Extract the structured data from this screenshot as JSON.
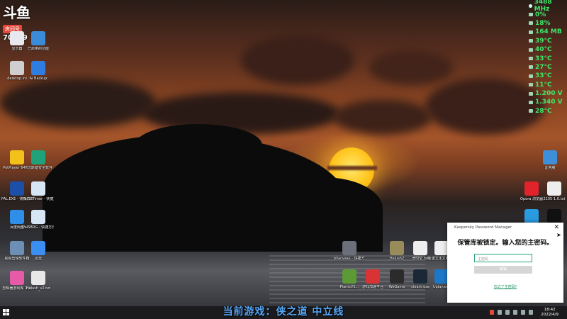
{
  "stream": {
    "logo": "斗鱼",
    "room_tag": "房间号",
    "room_number": "70249",
    "now_playing": "当前游戏：侠之道 中立线"
  },
  "desktop_icons_left": [
    {
      "label": "显示器",
      "icon": "network-icon",
      "color": "#e8e8f0"
    },
    {
      "label": "已启用的功能",
      "icon": "tools-icon",
      "color": "#3a8cd8"
    },
    {
      "label": "desktop.ini",
      "icon": "file-icon",
      "color": "#cfcfcf"
    },
    {
      "label": "Ai Backup",
      "icon": "backup-icon",
      "color": "#2f7de1"
    },
    {
      "label": "PotPlayer 64 bit",
      "icon": "potplayer-icon",
      "color": "#f2c21b"
    },
    {
      "label": "卡巴斯基安全软件",
      "icon": "kaspersky-icon",
      "color": "#1fa27a"
    },
    {
      "label": "PAL.EXE - 快捷方式",
      "icon": "pal-icon",
      "color": "#1b4fa8"
    },
    {
      "label": "PalSBTimer - 快捷方式",
      "icon": "window-icon",
      "color": "#d7e6f5"
    },
    {
      "label": "百度网盘",
      "icon": "baidu-pan-icon",
      "color": "#2f8fe8"
    },
    {
      "label": "PalSBRG - 快捷方式",
      "icon": "window-icon",
      "color": "#d7e6f5"
    },
    {
      "label": "视频剪辑软件箱",
      "icon": "gallery-icon",
      "color": "#6d8fb5"
    },
    {
      "label": "迅雷",
      "icon": "thunder-icon",
      "color": "#3b8ef2"
    },
    {
      "label": "剪辑器游戏库 工具",
      "icon": "game-tool-icon",
      "color": "#e65aa7"
    },
    {
      "label": "Helush_v2.txt",
      "icon": "text-file-icon",
      "color": "#e8e8e8"
    }
  ],
  "desktop_icons_bottom": [
    {
      "label": "bilacvase - 快捷方式",
      "icon": "game-icon",
      "color": "#6a6f7a"
    },
    {
      "label": "Helush2",
      "icon": "sword-icon",
      "color": "#9a8b5a"
    },
    {
      "label": "罗时空.txt",
      "icon": "text-file-icon",
      "color": "#eeeeee"
    },
    {
      "label": "新建文本文档.txt",
      "icon": "text-file-icon",
      "color": "#eeeeee"
    },
    {
      "label": "PlantsVS...",
      "icon": "plants-icon",
      "color": "#5c9a36"
    },
    {
      "label": "游戏加速平台",
      "icon": "accelerator-icon",
      "color": "#d93333"
    },
    {
      "label": "WeGame",
      "icon": "wegame-icon",
      "color": "#2b2b2b"
    },
    {
      "label": "steam.exe",
      "icon": "steam-icon",
      "color": "#1b2838"
    },
    {
      "label": "Uplay.exe",
      "icon": "uplay-icon",
      "color": "#1d77c8"
    }
  ],
  "desktop_icons_right": [
    {
      "label": "此电脑",
      "icon": "computer-icon",
      "color": "#3c8fd8"
    },
    {
      "label": "Opera 浏览器",
      "icon": "opera-icon",
      "color": "#e1232c"
    },
    {
      "label": "2105-1.0.txt",
      "icon": "text-file-icon",
      "color": "#eeeeee"
    },
    {
      "label": "",
      "icon": "app-icon",
      "color": "#2a9be0"
    },
    {
      "label": "",
      "icon": "qq-icon",
      "color": "#111111"
    }
  ],
  "system_monitor": [
    "3488 MHz",
    "0%",
    "18%",
    "164 MB",
    "39°C",
    "40°C",
    "33°C",
    "27°C",
    "33°C",
    "11°C",
    "1.200 V",
    "1.340 V",
    "28°C"
  ],
  "kaspersky": {
    "title": "Kaspersky Password Manager",
    "message": "保管库被锁定。输入您的主密码。",
    "password_placeholder": "主密码",
    "unlock_label": "解锁",
    "forgot_link": "忘记了主密码?",
    "close_glyph": "✕"
  },
  "taskbar": {
    "time": "18:42",
    "date": "2022/4/9"
  }
}
